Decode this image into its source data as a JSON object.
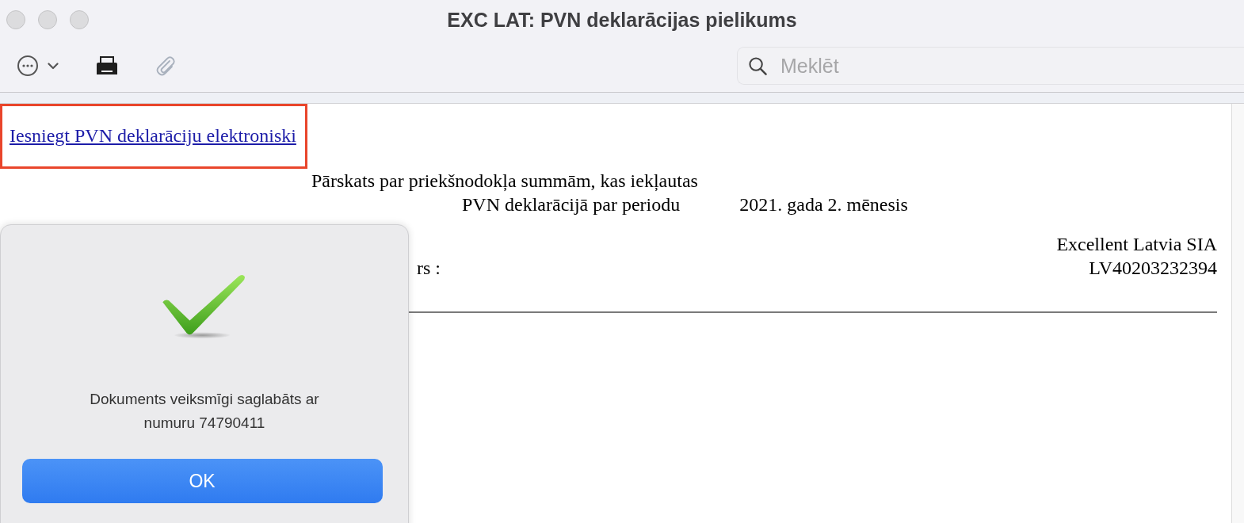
{
  "window": {
    "title": "EXC LAT: PVN deklarācijas pielikums"
  },
  "toolbar": {
    "buttons": [
      {
        "kind": "more",
        "disabled": false
      },
      {
        "kind": "print",
        "disabled": false
      },
      {
        "kind": "attach",
        "disabled": true
      }
    ]
  },
  "search": {
    "placeholder": "Meklēt"
  },
  "document": {
    "link": "Iesniegt PVN deklarāciju elektroniski",
    "highlighted": true,
    "heading_lines": [
      "Pārskats par priekšnodokļa summām, kas iekļautas",
      "PVN deklarācijā par periodu"
    ],
    "period": "2021. gada 2. mēnesis",
    "company": "Excellent Latvia SIA",
    "field_label": "rs :",
    "vat_number": "LV40203232394"
  },
  "dialog": {
    "kind": "success",
    "message": "Dokuments veiksmīgi saglabāts ar numuru 74790411",
    "button": "OK"
  }
}
